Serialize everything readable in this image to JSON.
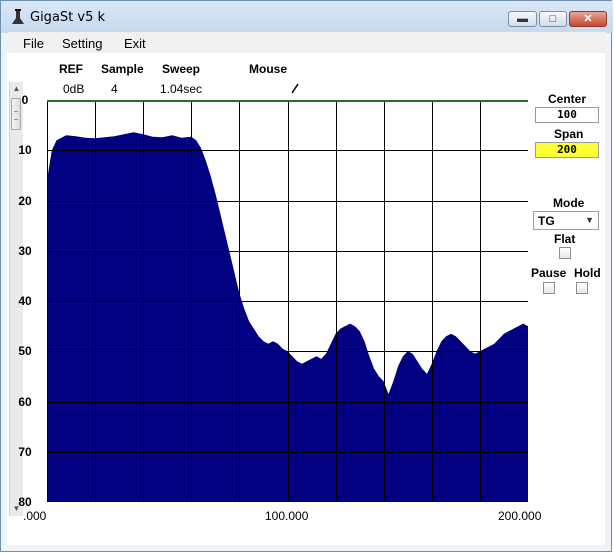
{
  "window": {
    "title": "GigaSt v5 k"
  },
  "menu": {
    "file": "File",
    "setting": "Setting",
    "exit": "Exit"
  },
  "header": {
    "ref_label": "REF",
    "ref_value": "0dB",
    "sample_label": "Sample",
    "sample_value": "4",
    "sweep_label": "Sweep",
    "sweep_value": "1.04sec",
    "mouse_label": "Mouse"
  },
  "side_panel": {
    "center_label": "Center",
    "center_value": "100",
    "span_label": "Span",
    "span_value": "200",
    "mode_label": "Mode",
    "mode_value": "TG",
    "flat_label": "Flat",
    "pause_label": "Pause",
    "hold_label": "Hold"
  },
  "colors": {
    "trace": "#000080",
    "trace_top": "#2e6b2e",
    "span_highlight": "#ffff33",
    "grid": "#000000"
  },
  "chart_data": {
    "type": "area",
    "x_ticks": [
      ".000",
      "100.000",
      "200.000"
    ],
    "y_ticks": [
      "0",
      "10",
      "20",
      "30",
      "40",
      "50",
      "60",
      "70",
      "80"
    ],
    "xlim": [
      0,
      200
    ],
    "ylim": [
      0,
      80
    ],
    "y_inverted": true,
    "grid": true,
    "series": [
      {
        "x": [
          0,
          2,
          4,
          6,
          8,
          12,
          16,
          20,
          24,
          28,
          32,
          36,
          40,
          44,
          48,
          52,
          56,
          60,
          62,
          64,
          66,
          68,
          70,
          72,
          74,
          76,
          78,
          80,
          82,
          84,
          86,
          88,
          90,
          92,
          94,
          96,
          98,
          100,
          102,
          104,
          106,
          108,
          110,
          112,
          114,
          116,
          118,
          120,
          122,
          124,
          126,
          128,
          130,
          132,
          134,
          136,
          138,
          140,
          142,
          144,
          146,
          148,
          150,
          152,
          154,
          156,
          158,
          160,
          162,
          164,
          166,
          168,
          170,
          172,
          174,
          176,
          178,
          180,
          182,
          184,
          186,
          188,
          190,
          192,
          194,
          196,
          198,
          200
        ],
        "values": [
          16,
          10,
          8,
          7.5,
          7,
          7.2,
          7.5,
          7.6,
          7.4,
          7.2,
          6.8,
          6.4,
          6.8,
          7.3,
          7.4,
          7,
          7.5,
          7.3,
          8,
          9.5,
          12,
          15,
          18.5,
          22.5,
          26.5,
          30.5,
          34.5,
          38.5,
          41.5,
          44,
          45.5,
          47,
          48,
          48.5,
          48,
          48.5,
          49.5,
          50,
          51,
          52,
          52.5,
          52,
          51.5,
          51,
          51.5,
          50.5,
          48.5,
          46.5,
          45.5,
          45,
          44.5,
          45,
          46,
          48,
          51,
          53.5,
          55,
          56,
          58.5,
          56,
          53,
          51,
          50,
          50.5,
          52,
          53.5,
          54.5,
          52.5,
          50,
          48,
          47,
          46.5,
          47,
          48,
          49,
          50,
          50.5,
          50,
          49.5,
          49,
          48.5,
          47.5,
          46.5,
          46,
          45.5,
          45,
          44.5,
          45
        ]
      }
    ]
  }
}
